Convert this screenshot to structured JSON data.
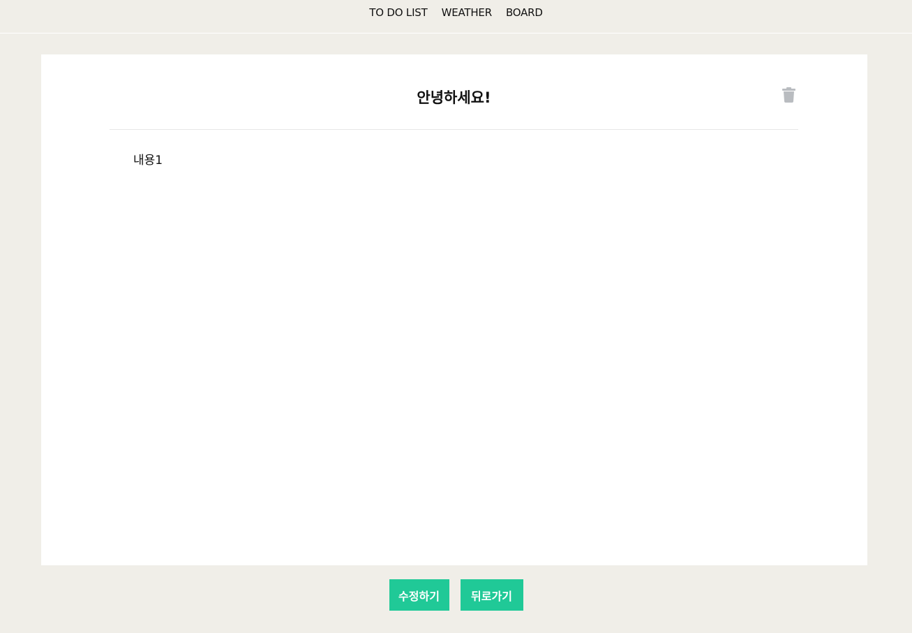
{
  "nav": {
    "items": [
      {
        "label": "TO DO LIST"
      },
      {
        "label": "WEATHER"
      },
      {
        "label": "BOARD"
      }
    ]
  },
  "post": {
    "title": "안녕하세요!",
    "content": "내용1",
    "delete_icon": "trash-icon"
  },
  "actions": {
    "edit_label": "수정하기",
    "back_label": "뒤로가기"
  },
  "colors": {
    "page_background": "#f0eee8",
    "card_background": "#ffffff",
    "button_accent": "#20c997",
    "icon_gray": "#b9bcc0"
  }
}
